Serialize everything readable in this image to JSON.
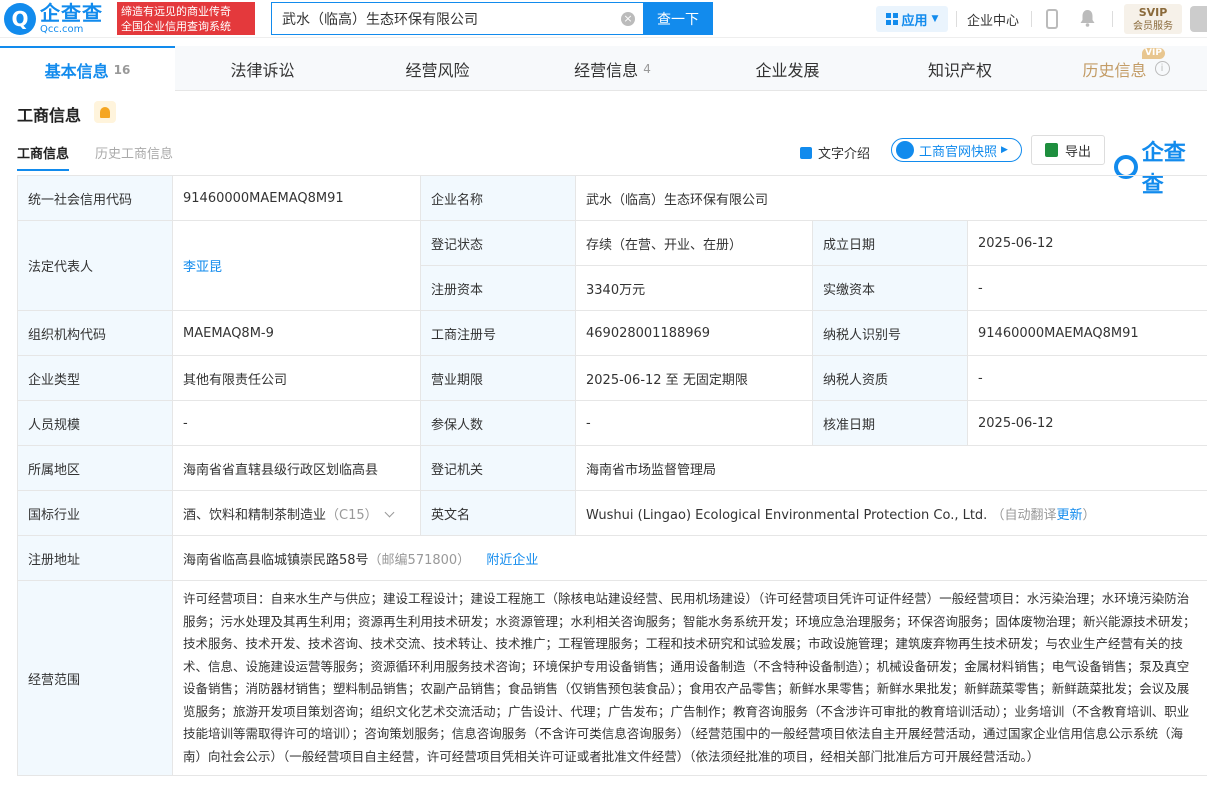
{
  "header": {
    "logo_cn": "企查查",
    "logo_en": "Qcc.com",
    "slogan_line1": "缔造有远见的商业传奇",
    "slogan_line2": "全国企业信用查询系统",
    "search_value": "武水（临高）生态环保有限公司",
    "search_button": "查一下",
    "app_label": "应用",
    "enterprise_center": "企业中心",
    "svip_label": "SVIP",
    "svip_sub": "会员服务"
  },
  "tabs": [
    {
      "label": "基本信息",
      "count": "16"
    },
    {
      "label": "法律诉讼",
      "count": ""
    },
    {
      "label": "经营风险",
      "count": ""
    },
    {
      "label": "经营信息",
      "count": "4"
    },
    {
      "label": "企业发展",
      "count": ""
    },
    {
      "label": "知识产权",
      "count": ""
    },
    {
      "label": "历史信息",
      "count": ""
    }
  ],
  "vip_badge": "VIP",
  "section": {
    "title": "工商信息",
    "subtab_active": "工商信息",
    "subtab_inactive": "历史工商信息",
    "action_text_intro": "文字介绍",
    "action_snapshot": "工商官网快照",
    "action_export": "导出",
    "brand": "企查查"
  },
  "info": {
    "credit_code_label": "统一社会信用代码",
    "credit_code": "91460000MAEMAQ8M91",
    "company_name_label": "企业名称",
    "company_name": "武水（临高）生态环保有限公司",
    "legal_rep_label": "法定代表人",
    "legal_rep": "李亚昆",
    "reg_status_label": "登记状态",
    "reg_status": "存续（在营、开业、在册）",
    "est_date_label": "成立日期",
    "est_date": "2025-06-12",
    "reg_capital_label": "注册资本",
    "reg_capital": "3340万元",
    "paid_capital_label": "实缴资本",
    "paid_capital": "-",
    "org_code_label": "组织机构代码",
    "org_code": "MAEMAQ8M-9",
    "biz_reg_no_label": "工商注册号",
    "biz_reg_no": "469028001188969",
    "taxpayer_id_label": "纳税人识别号",
    "taxpayer_id": "91460000MAEMAQ8M91",
    "ent_type_label": "企业类型",
    "ent_type": "其他有限责任公司",
    "biz_term_label": "营业期限",
    "biz_term": "2025-06-12 至 无固定期限",
    "taxpayer_qual_label": "纳税人资质",
    "taxpayer_qual": "-",
    "staff_size_label": "人员规模",
    "staff_size": "-",
    "insured_label": "参保人数",
    "insured": "-",
    "approval_date_label": "核准日期",
    "approval_date": "2025-06-12",
    "region_label": "所属地区",
    "region": "海南省省直辖县级行政区划临高县",
    "reg_authority_label": "登记机关",
    "reg_authority": "海南省市场监督管理局",
    "industry_label": "国标行业",
    "industry": "酒、饮料和精制茶制造业",
    "industry_code": "（C15）",
    "english_name_label": "英文名",
    "english_name": "Wushui (Lingao) Ecological Environmental Protection Co., Ltd.",
    "auto_translate": "（自动翻译",
    "update_link": "更新",
    "auto_translate_end": "）",
    "address_label": "注册地址",
    "address": "海南省临高县临城镇崇民路58号",
    "postcode": "（邮编571800）",
    "nearby_link": "附近企业",
    "scope_label": "经营范围",
    "scope": "许可经营项目：自来水生产与供应；建设工程设计；建设工程施工（除核电站建设经营、民用机场建设）（许可经营项目凭许可证件经营）一般经营项目：水污染治理；水环境污染防治服务；污水处理及其再生利用；资源再生利用技术研发；水资源管理；水利相关咨询服务；智能水务系统开发；环境应急治理服务；环保咨询服务；固体废物治理；新兴能源技术研发；技术服务、技术开发、技术咨询、技术交流、技术转让、技术推广；工程管理服务；工程和技术研究和试验发展；市政设施管理；建筑废弃物再生技术研发；与农业生产经营有关的技术、信息、设施建设运营等服务；资源循环利用服务技术咨询；环境保护专用设备销售；通用设备制造（不含特种设备制造）；机械设备研发；金属材料销售；电气设备销售；泵及真空设备销售；消防器材销售；塑料制品销售；农副产品销售；食品销售（仅销售预包装食品）；食用农产品零售；新鲜水果零售；新鲜水果批发；新鲜蔬菜零售；新鲜蔬菜批发；会议及展览服务；旅游开发项目策划咨询；组织文化艺术交流活动；广告设计、代理；广告发布；广告制作；教育咨询服务（不含涉许可审批的教育培训活动）；业务培训（不含教育培训、职业技能培训等需取得许可的培训）；咨询策划服务；信息咨询服务（不含许可类信息咨询服务）（经营范围中的一般经营项目依法自主开展经营活动，通过国家企业信用信息公示系统（海南）向社会公示）（一般经营项目自主经营，许可经营项目凭相关许可证或者批准文件经营）（依法须经批准的项目，经相关部门批准后方可开展经营活动。）"
  }
}
